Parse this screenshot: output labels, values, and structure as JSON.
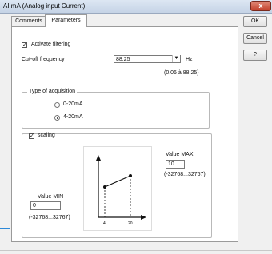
{
  "window": {
    "title": "AI mA (Analog input Current)",
    "close_symbol": "x"
  },
  "tabs": [
    {
      "label": "Comments"
    },
    {
      "label": "Parameters"
    }
  ],
  "buttons": {
    "ok": "OK",
    "cancel": "Cancel",
    "help": "?"
  },
  "filtering": {
    "checkbox_label": "Activate filtering",
    "checked": true,
    "cutoff_label": "Cut-off frequency",
    "cutoff_value": "88.25",
    "unit": "Hz",
    "range": "(0.06 à 88.25)"
  },
  "acquisition": {
    "title": "Type of acquisition",
    "options": [
      {
        "label": "0-20mA",
        "selected": false
      },
      {
        "label": "4-20mA",
        "selected": true
      }
    ]
  },
  "scaling": {
    "checkbox_label": "scaling",
    "checked": true,
    "max_label": "Value MAX",
    "max_value": "10",
    "max_range": "(-32768...32767)",
    "min_label": "Value MIN",
    "min_value": "0",
    "min_range": "(-32768...32767)",
    "graph_x_labels": [
      "4",
      "20"
    ]
  },
  "colors": {
    "accent": "#2e89d8",
    "close": "#c2402a"
  }
}
